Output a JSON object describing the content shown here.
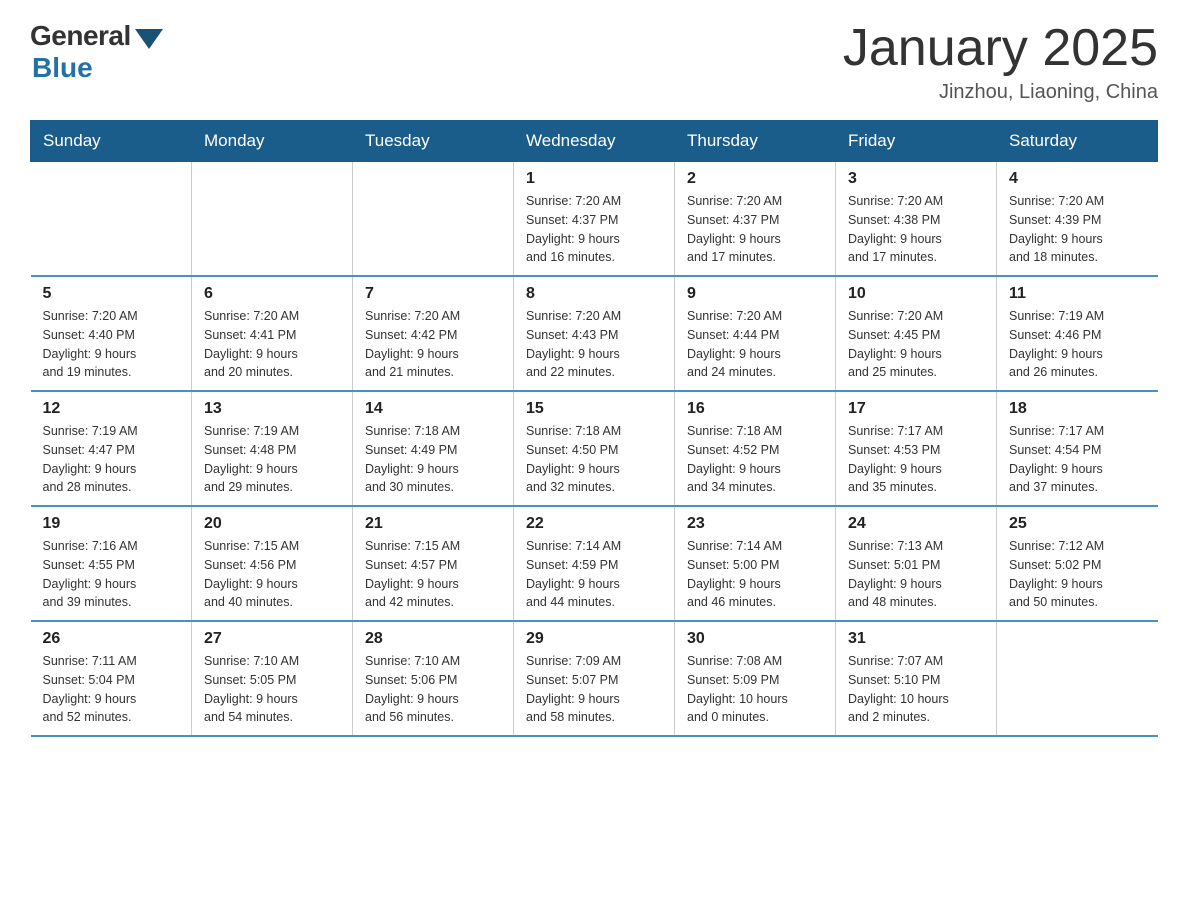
{
  "header": {
    "logo_general": "General",
    "logo_blue": "Blue",
    "month_title": "January 2025",
    "location": "Jinzhou, Liaoning, China"
  },
  "weekdays": [
    "Sunday",
    "Monday",
    "Tuesday",
    "Wednesday",
    "Thursday",
    "Friday",
    "Saturday"
  ],
  "weeks": [
    [
      {
        "day": "",
        "info": ""
      },
      {
        "day": "",
        "info": ""
      },
      {
        "day": "",
        "info": ""
      },
      {
        "day": "1",
        "info": "Sunrise: 7:20 AM\nSunset: 4:37 PM\nDaylight: 9 hours\nand 16 minutes."
      },
      {
        "day": "2",
        "info": "Sunrise: 7:20 AM\nSunset: 4:37 PM\nDaylight: 9 hours\nand 17 minutes."
      },
      {
        "day": "3",
        "info": "Sunrise: 7:20 AM\nSunset: 4:38 PM\nDaylight: 9 hours\nand 17 minutes."
      },
      {
        "day": "4",
        "info": "Sunrise: 7:20 AM\nSunset: 4:39 PM\nDaylight: 9 hours\nand 18 minutes."
      }
    ],
    [
      {
        "day": "5",
        "info": "Sunrise: 7:20 AM\nSunset: 4:40 PM\nDaylight: 9 hours\nand 19 minutes."
      },
      {
        "day": "6",
        "info": "Sunrise: 7:20 AM\nSunset: 4:41 PM\nDaylight: 9 hours\nand 20 minutes."
      },
      {
        "day": "7",
        "info": "Sunrise: 7:20 AM\nSunset: 4:42 PM\nDaylight: 9 hours\nand 21 minutes."
      },
      {
        "day": "8",
        "info": "Sunrise: 7:20 AM\nSunset: 4:43 PM\nDaylight: 9 hours\nand 22 minutes."
      },
      {
        "day": "9",
        "info": "Sunrise: 7:20 AM\nSunset: 4:44 PM\nDaylight: 9 hours\nand 24 minutes."
      },
      {
        "day": "10",
        "info": "Sunrise: 7:20 AM\nSunset: 4:45 PM\nDaylight: 9 hours\nand 25 minutes."
      },
      {
        "day": "11",
        "info": "Sunrise: 7:19 AM\nSunset: 4:46 PM\nDaylight: 9 hours\nand 26 minutes."
      }
    ],
    [
      {
        "day": "12",
        "info": "Sunrise: 7:19 AM\nSunset: 4:47 PM\nDaylight: 9 hours\nand 28 minutes."
      },
      {
        "day": "13",
        "info": "Sunrise: 7:19 AM\nSunset: 4:48 PM\nDaylight: 9 hours\nand 29 minutes."
      },
      {
        "day": "14",
        "info": "Sunrise: 7:18 AM\nSunset: 4:49 PM\nDaylight: 9 hours\nand 30 minutes."
      },
      {
        "day": "15",
        "info": "Sunrise: 7:18 AM\nSunset: 4:50 PM\nDaylight: 9 hours\nand 32 minutes."
      },
      {
        "day": "16",
        "info": "Sunrise: 7:18 AM\nSunset: 4:52 PM\nDaylight: 9 hours\nand 34 minutes."
      },
      {
        "day": "17",
        "info": "Sunrise: 7:17 AM\nSunset: 4:53 PM\nDaylight: 9 hours\nand 35 minutes."
      },
      {
        "day": "18",
        "info": "Sunrise: 7:17 AM\nSunset: 4:54 PM\nDaylight: 9 hours\nand 37 minutes."
      }
    ],
    [
      {
        "day": "19",
        "info": "Sunrise: 7:16 AM\nSunset: 4:55 PM\nDaylight: 9 hours\nand 39 minutes."
      },
      {
        "day": "20",
        "info": "Sunrise: 7:15 AM\nSunset: 4:56 PM\nDaylight: 9 hours\nand 40 minutes."
      },
      {
        "day": "21",
        "info": "Sunrise: 7:15 AM\nSunset: 4:57 PM\nDaylight: 9 hours\nand 42 minutes."
      },
      {
        "day": "22",
        "info": "Sunrise: 7:14 AM\nSunset: 4:59 PM\nDaylight: 9 hours\nand 44 minutes."
      },
      {
        "day": "23",
        "info": "Sunrise: 7:14 AM\nSunset: 5:00 PM\nDaylight: 9 hours\nand 46 minutes."
      },
      {
        "day": "24",
        "info": "Sunrise: 7:13 AM\nSunset: 5:01 PM\nDaylight: 9 hours\nand 48 minutes."
      },
      {
        "day": "25",
        "info": "Sunrise: 7:12 AM\nSunset: 5:02 PM\nDaylight: 9 hours\nand 50 minutes."
      }
    ],
    [
      {
        "day": "26",
        "info": "Sunrise: 7:11 AM\nSunset: 5:04 PM\nDaylight: 9 hours\nand 52 minutes."
      },
      {
        "day": "27",
        "info": "Sunrise: 7:10 AM\nSunset: 5:05 PM\nDaylight: 9 hours\nand 54 minutes."
      },
      {
        "day": "28",
        "info": "Sunrise: 7:10 AM\nSunset: 5:06 PM\nDaylight: 9 hours\nand 56 minutes."
      },
      {
        "day": "29",
        "info": "Sunrise: 7:09 AM\nSunset: 5:07 PM\nDaylight: 9 hours\nand 58 minutes."
      },
      {
        "day": "30",
        "info": "Sunrise: 7:08 AM\nSunset: 5:09 PM\nDaylight: 10 hours\nand 0 minutes."
      },
      {
        "day": "31",
        "info": "Sunrise: 7:07 AM\nSunset: 5:10 PM\nDaylight: 10 hours\nand 2 minutes."
      },
      {
        "day": "",
        "info": ""
      }
    ]
  ]
}
